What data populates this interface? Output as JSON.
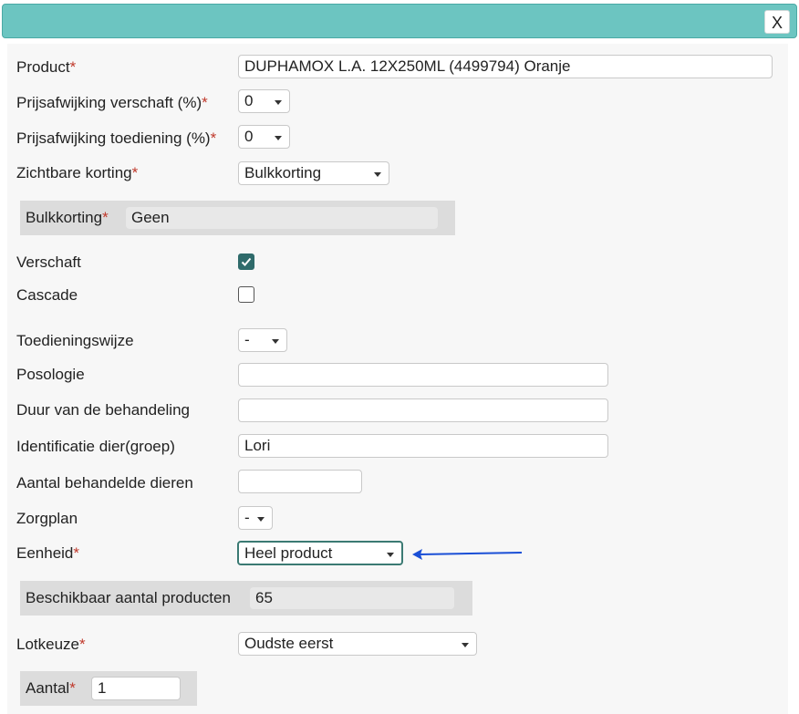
{
  "dialog": {
    "close_label": "X"
  },
  "form": {
    "product": {
      "label": "Product",
      "value": "DUPHAMOX L.A. 12X250ML (4499794) Oranje"
    },
    "prijs_verschaft": {
      "label": "Prijsafwijking verschaft (%)",
      "value": "0"
    },
    "prijs_toediening": {
      "label": "Prijsafwijking toediening (%)",
      "value": "0"
    },
    "zichtbare_korting": {
      "label": "Zichtbare korting",
      "value": "Bulkkorting"
    },
    "bulkkorting": {
      "label": "Bulkkorting",
      "value": "Geen"
    },
    "verschaft": {
      "label": "Verschaft",
      "checked": true
    },
    "cascade": {
      "label": "Cascade",
      "checked": false
    },
    "toedieningswijze": {
      "label": "Toedieningswijze",
      "value": "-"
    },
    "posologie": {
      "label": "Posologie",
      "value": ""
    },
    "duur": {
      "label": "Duur van de behandeling",
      "value": ""
    },
    "identificatie": {
      "label": "Identificatie dier(groep)",
      "value": "Lori"
    },
    "aantal_dieren": {
      "label": "Aantal behandelde dieren",
      "value": ""
    },
    "zorgplan": {
      "label": "Zorgplan",
      "value": "-"
    },
    "eenheid": {
      "label": "Eenheid",
      "value": "Heel product"
    },
    "beschikbaar": {
      "label": "Beschikbaar aantal producten",
      "value": "65"
    },
    "lotkeuze": {
      "label": "Lotkeuze",
      "value": "Oudste eerst"
    },
    "aantal": {
      "label": "Aantal",
      "value": "1"
    }
  },
  "colors": {
    "titlebar": "#6cc5c1",
    "required": "#c0392b",
    "arrow": "#1a4fd6",
    "checkbox": "#2f6b6b"
  }
}
